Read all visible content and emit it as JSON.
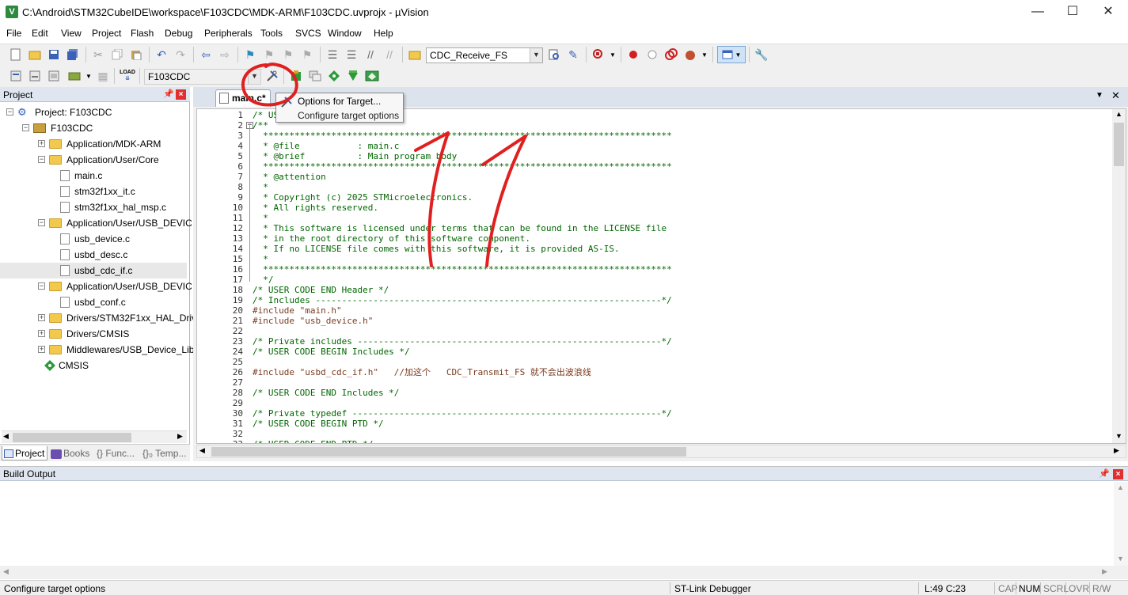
{
  "window": {
    "title": "C:\\Android\\STM32CubeIDE\\workspace\\F103CDC\\MDK-ARM\\F103CDC.uvprojx - µVision",
    "app_icon": "V",
    "minimize": "—",
    "maximize": "☐",
    "close": "✕"
  },
  "menu": [
    "File",
    "Edit",
    "View",
    "Project",
    "Flash",
    "Debug",
    "Peripherals",
    "Tools",
    "SVCS",
    "Window",
    "Help"
  ],
  "toolbar": {
    "find_combo": "CDC_Receive_FS",
    "target_combo": "F103CDC",
    "load_label": "LOAD"
  },
  "project_panel": {
    "title": "Project",
    "tree": [
      {
        "label": "Project: F103CDC",
        "level": 0,
        "kind": "project",
        "exp": "−"
      },
      {
        "label": "F103CDC",
        "level": 1,
        "kind": "target",
        "exp": "−"
      },
      {
        "label": "Application/MDK-ARM",
        "level": 2,
        "kind": "folder",
        "exp": "+"
      },
      {
        "label": "Application/User/Core",
        "level": 2,
        "kind": "folder",
        "exp": "−"
      },
      {
        "label": "main.c",
        "level": 3,
        "kind": "file"
      },
      {
        "label": "stm32f1xx_it.c",
        "level": 3,
        "kind": "file"
      },
      {
        "label": "stm32f1xx_hal_msp.c",
        "level": 3,
        "kind": "file"
      },
      {
        "label": "Application/User/USB_DEVIC",
        "level": 2,
        "kind": "folder",
        "exp": "−"
      },
      {
        "label": "usb_device.c",
        "level": 3,
        "kind": "file"
      },
      {
        "label": "usbd_desc.c",
        "level": 3,
        "kind": "file"
      },
      {
        "label": "usbd_cdc_if.c",
        "level": 3,
        "kind": "file",
        "selected": true
      },
      {
        "label": "Application/User/USB_DEVIC",
        "level": 2,
        "kind": "folder",
        "exp": "−"
      },
      {
        "label": "usbd_conf.c",
        "level": 3,
        "kind": "file"
      },
      {
        "label": "Drivers/STM32F1xx_HAL_Driv",
        "level": 2,
        "kind": "folder",
        "exp": "+"
      },
      {
        "label": "Drivers/CMSIS",
        "level": 2,
        "kind": "folder",
        "exp": "+"
      },
      {
        "label": "Middlewares/USB_Device_Lib",
        "level": 2,
        "kind": "folder",
        "exp": "+"
      },
      {
        "label": "CMSIS",
        "level": 2,
        "kind": "component"
      }
    ],
    "tabs": [
      "Project",
      "Books",
      "{} Func...",
      "{}₀ Temp..."
    ]
  },
  "editor": {
    "tab_label": "main.c*",
    "lines": [
      {
        "n": "1",
        "t": "/* USER CODE BEGIN Header */",
        "c": "comment"
      },
      {
        "n": "2",
        "t": "/**",
        "c": "comment",
        "fold": "−"
      },
      {
        "n": "3",
        "t": "  ******************************************************************************",
        "c": "comment"
      },
      {
        "n": "4",
        "t": "  * @file           : main.c",
        "c": "comment"
      },
      {
        "n": "5",
        "t": "  * @brief          : Main program body",
        "c": "comment"
      },
      {
        "n": "6",
        "t": "  ******************************************************************************",
        "c": "comment"
      },
      {
        "n": "7",
        "t": "  * @attention",
        "c": "comment"
      },
      {
        "n": "8",
        "t": "  *",
        "c": "comment"
      },
      {
        "n": "9",
        "t": "  * Copyright (c) 2025 STMicroelectronics.",
        "c": "comment"
      },
      {
        "n": "10",
        "t": "  * All rights reserved.",
        "c": "comment"
      },
      {
        "n": "11",
        "t": "  *",
        "c": "comment"
      },
      {
        "n": "12",
        "t": "  * This software is licensed under terms that can be found in the LICENSE file",
        "c": "comment"
      },
      {
        "n": "13",
        "t": "  * in the root directory of this software component.",
        "c": "comment"
      },
      {
        "n": "14",
        "t": "  * If no LICENSE file comes with this software, it is provided AS-IS.",
        "c": "comment"
      },
      {
        "n": "15",
        "t": "  *",
        "c": "comment"
      },
      {
        "n": "16",
        "t": "  ******************************************************************************",
        "c": "comment"
      },
      {
        "n": "17",
        "t": "  */",
        "c": "comment"
      },
      {
        "n": "18",
        "t": "/* USER CODE END Header */",
        "c": "comment"
      },
      {
        "n": "19",
        "t": "/* Includes ------------------------------------------------------------------*/",
        "c": "comment"
      },
      {
        "n": "20",
        "t": "#include \"main.h\"",
        "c": "pre"
      },
      {
        "n": "21",
        "t": "#include \"usb_device.h\"",
        "c": "pre"
      },
      {
        "n": "22",
        "t": "",
        "c": "plain"
      },
      {
        "n": "23",
        "t": "/* Private includes ----------------------------------------------------------*/",
        "c": "comment"
      },
      {
        "n": "24",
        "t": "/* USER CODE BEGIN Includes */",
        "c": "comment"
      },
      {
        "n": "25",
        "t": "",
        "c": "plain"
      },
      {
        "n": "26",
        "t": "#include \"usbd_cdc_if.h\"   //加这个   CDC_Transmit_FS 就不会出波浪线",
        "c": "pre"
      },
      {
        "n": "27",
        "t": "",
        "c": "plain"
      },
      {
        "n": "28",
        "t": "/* USER CODE END Includes */",
        "c": "comment"
      },
      {
        "n": "29",
        "t": "",
        "c": "plain"
      },
      {
        "n": "30",
        "t": "/* Private typedef -----------------------------------------------------------*/",
        "c": "comment"
      },
      {
        "n": "31",
        "t": "/* USER CODE BEGIN PTD */",
        "c": "comment"
      },
      {
        "n": "32",
        "t": "",
        "c": "plain"
      },
      {
        "n": "33",
        "t": "/* USER CODE END PTD */",
        "c": "comment"
      }
    ]
  },
  "tooltip": {
    "title": "Options for Target...",
    "description": "Configure target options"
  },
  "build_output": {
    "title": "Build Output"
  },
  "status_bar": {
    "message": "Configure target options",
    "debugger": "ST-Link Debugger",
    "position": "L:49 C:23",
    "cap": "CAP",
    "num": "NUM",
    "scrl": "SCRL",
    "ovr": "OVR",
    "rw": "R/W"
  },
  "colors": {
    "comment": "#006600",
    "preprocessor": "#7a3b1e",
    "annotation": "#e02020",
    "panel_header": "#dfe6f0"
  }
}
